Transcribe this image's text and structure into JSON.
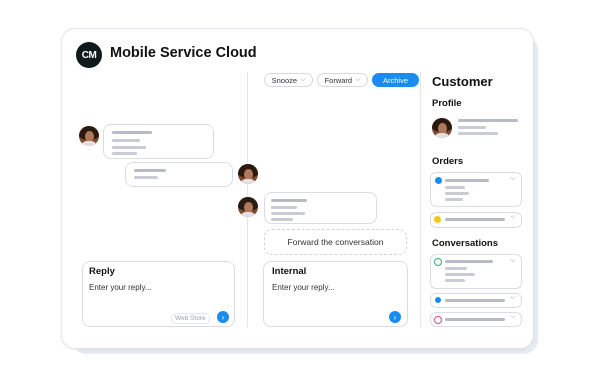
{
  "app": {
    "title": "Mobile Service Cloud",
    "logo_text": "CM"
  },
  "toolbar": {
    "snooze_label": "Snooze",
    "forward_label": "Forward",
    "archive_label": "Archive"
  },
  "conversation": {
    "forward_label": "Forward the conversation"
  },
  "reply": {
    "title": "Reply",
    "placeholder": "Enter your reply...",
    "channel_tag": "Web Store"
  },
  "internal": {
    "title": "Internal",
    "placeholder": "Enter your reply..."
  },
  "customer": {
    "heading": "Customer",
    "profile_label": "Profile",
    "orders_label": "Orders",
    "conversations_label": "Conversations"
  },
  "colors": {
    "accent": "#1a8cf0",
    "order_dot_1": "#1a8cf0",
    "order_dot_2": "#f5c518",
    "conv_green": "#2fb36a",
    "conv_blue": "#1a8cf0",
    "conv_pink": "#e0487a"
  },
  "icons": [
    "cm-logo-icon",
    "chevron-down-icon",
    "send-icon",
    "avatar-icon",
    "whatsapp-icon",
    "instagram-icon"
  ]
}
